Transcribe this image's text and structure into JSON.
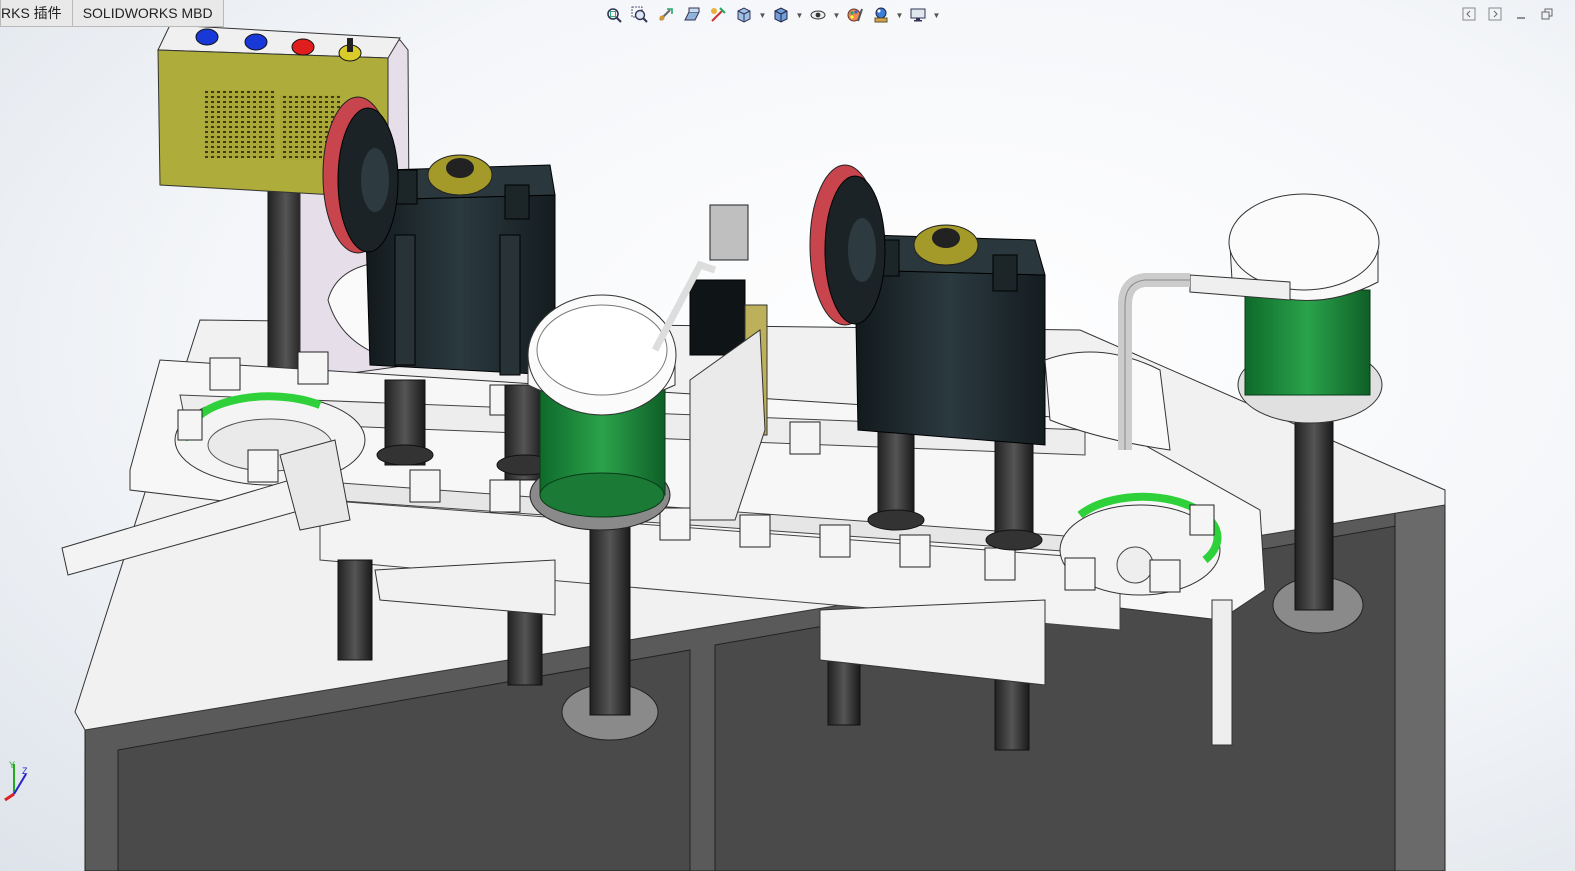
{
  "tabs": [
    {
      "label": "RKS 插件"
    },
    {
      "label": "SOLIDWORKS MBD"
    }
  ],
  "heads_up_toolbar": [
    {
      "icon": "zoom-to-fit-icon"
    },
    {
      "icon": "zoom-to-area-icon"
    },
    {
      "icon": "previous-view-icon"
    },
    {
      "icon": "section-view-icon"
    },
    {
      "icon": "dynamic-annotation-views-icon"
    },
    {
      "icon": "view-orientation-icon",
      "dropdown": true
    },
    {
      "icon": "display-style-icon",
      "dropdown": true
    },
    {
      "icon": "hide-show-items-icon",
      "dropdown": true
    },
    {
      "icon": "edit-appearance-icon"
    },
    {
      "icon": "apply-scene-icon",
      "dropdown": true
    },
    {
      "icon": "view-settings-icon",
      "dropdown": true
    }
  ],
  "window_controls": [
    {
      "icon": "collapse-left-icon"
    },
    {
      "icon": "collapse-right-icon"
    },
    {
      "icon": "minimize-icon"
    },
    {
      "icon": "restore-icon"
    }
  ],
  "triad": {
    "x_color": "#d22",
    "y_color": "#2a2",
    "z_color": "#22c"
  },
  "colors": {
    "control_box": "#aeac3a",
    "machine_dark": "#1f2a2e",
    "hopper_green": "#1f8a3c",
    "track_green": "#2fd13a",
    "pulley_red": "#c8454d",
    "frame_white": "#f2f2f2"
  }
}
